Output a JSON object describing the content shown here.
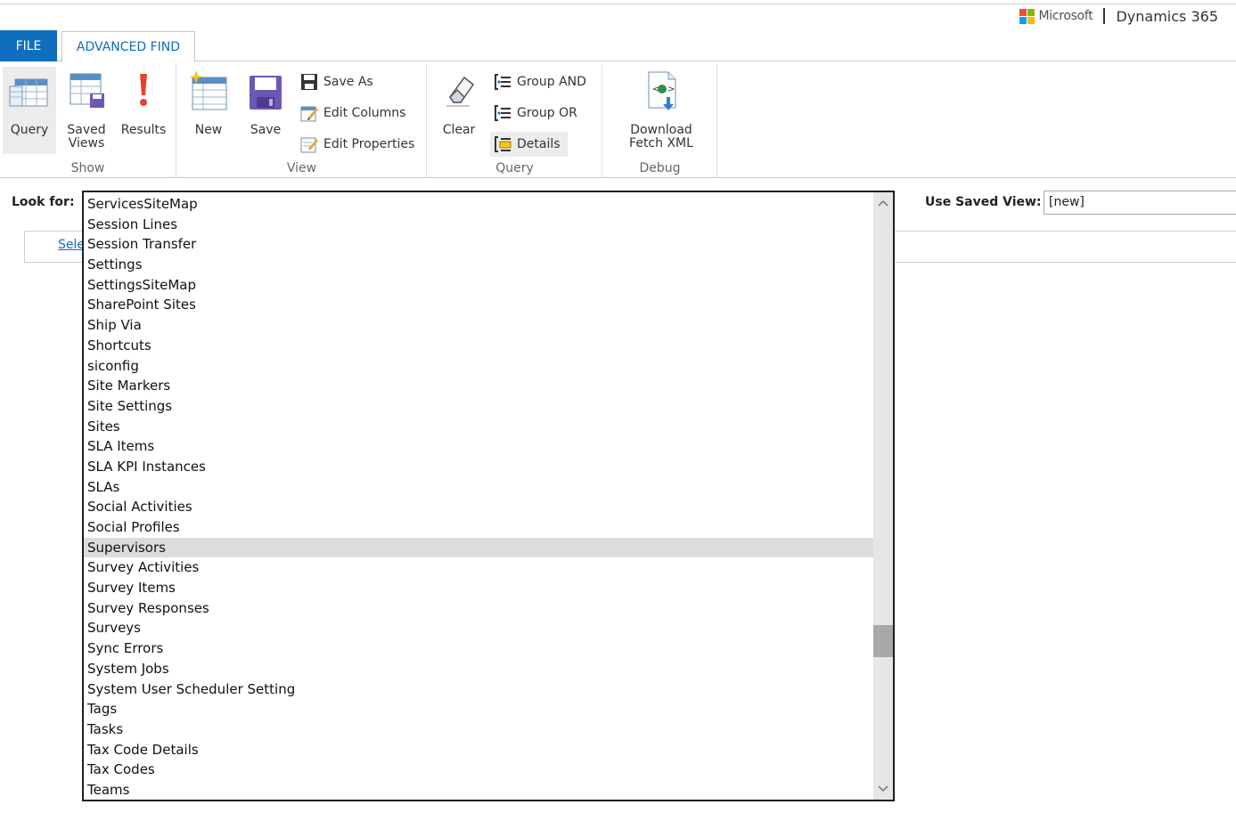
{
  "brand": {
    "company": "Microsoft",
    "product": "Dynamics 365",
    "logo_colors": [
      "#f25022",
      "#7fba00",
      "#00a4ef",
      "#ffb900"
    ]
  },
  "tabs": {
    "file": "FILE",
    "advanced_find": "ADVANCED FIND"
  },
  "ribbon": {
    "show": {
      "label": "Show",
      "query": "Query",
      "saved_views": "Saved Views",
      "results": "Results"
    },
    "view": {
      "label": "View",
      "new": "New",
      "save": "Save",
      "save_as": "Save As",
      "edit_columns": "Edit Columns",
      "edit_properties": "Edit Properties"
    },
    "query": {
      "label": "Query",
      "clear": "Clear",
      "group_and": "Group AND",
      "group_or": "Group OR",
      "details": "Details"
    },
    "debug": {
      "label": "Debug",
      "download_fetch_xml": "Download Fetch XML"
    }
  },
  "look_for": {
    "label": "Look for:",
    "selected": "Supervisors",
    "options": [
      "ServicesSiteMap",
      "Session Lines",
      "Session Transfer",
      "Settings",
      "SettingsSiteMap",
      "SharePoint Sites",
      "Ship Via",
      "Shortcuts",
      "siconfig",
      "Site Markers",
      "Site Settings",
      "Sites",
      "SLA Items",
      "SLA KPI Instances",
      "SLAs",
      "Social Activities",
      "Social Profiles",
      "Supervisors",
      "Survey Activities",
      "Survey Items",
      "Survey Responses",
      "Surveys",
      "Sync Errors",
      "System Jobs",
      "System User Scheduler Setting",
      "Tags",
      "Tasks",
      "Tax Code Details",
      "Tax Codes",
      "Teams"
    ],
    "scroll_position": 0.77
  },
  "saved_view": {
    "label": "Use Saved View:",
    "value": "[new]"
  },
  "select_link": "Sele"
}
